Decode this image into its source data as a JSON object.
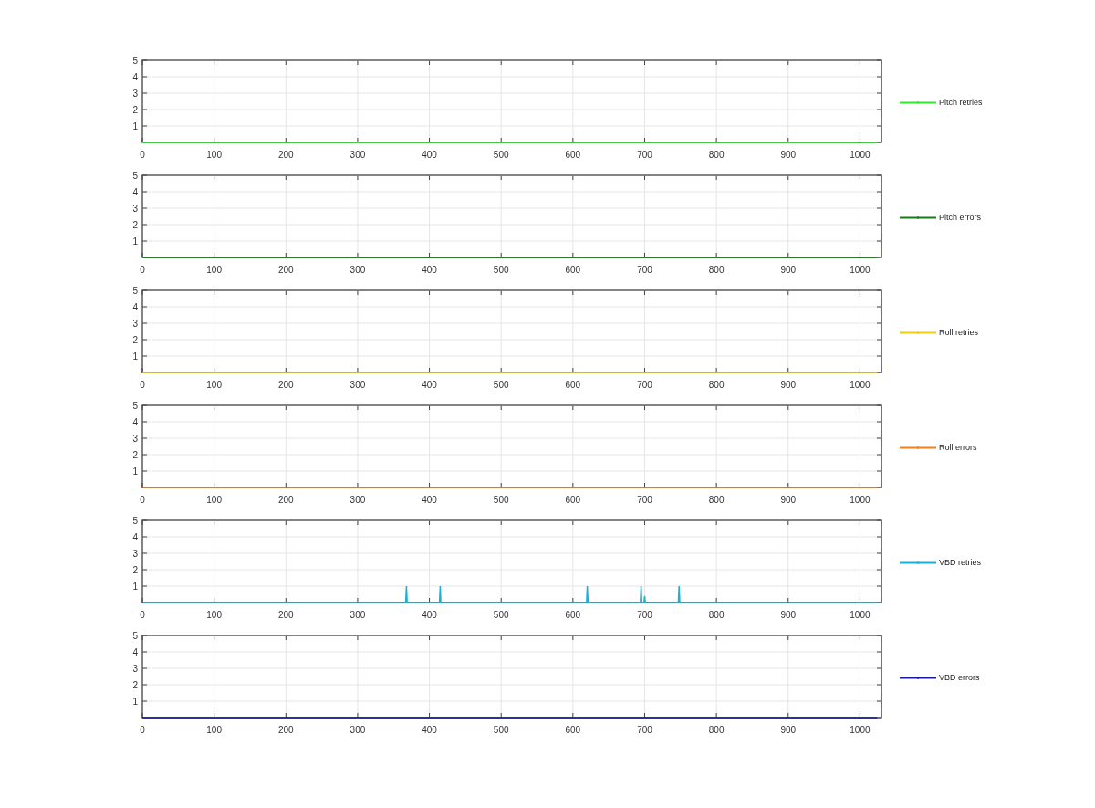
{
  "panels": [
    {
      "chart_data": {
        "type": "line",
        "x": [
          0,
          1024
        ],
        "series": [
          {
            "name": "Pitch retries",
            "color": "#33e633",
            "values": [
              0,
              0
            ]
          }
        ],
        "grid": true,
        "xlim": [
          0,
          1030
        ],
        "ylim": [
          0,
          5
        ],
        "xticks": [
          0,
          100,
          200,
          300,
          400,
          500,
          600,
          700,
          800,
          900,
          1000
        ],
        "yticks": [
          1,
          2,
          3,
          4,
          5
        ]
      }
    },
    {
      "chart_data": {
        "type": "line",
        "x": [
          0,
          1024
        ],
        "series": [
          {
            "name": "Pitch errors",
            "color": "#1a7a1a",
            "values": [
              0,
              0
            ]
          }
        ],
        "grid": true,
        "xlim": [
          0,
          1030
        ],
        "ylim": [
          0,
          5
        ],
        "xticks": [
          0,
          100,
          200,
          300,
          400,
          500,
          600,
          700,
          800,
          900,
          1000
        ],
        "yticks": [
          1,
          2,
          3,
          4,
          5
        ]
      }
    },
    {
      "chart_data": {
        "type": "line",
        "x": [
          0,
          1024
        ],
        "series": [
          {
            "name": "Roll retries",
            "color": "#f2cc1a",
            "values": [
              0,
              0
            ]
          }
        ],
        "grid": true,
        "xlim": [
          0,
          1030
        ],
        "ylim": [
          0,
          5
        ],
        "xticks": [
          0,
          100,
          200,
          300,
          400,
          500,
          600,
          700,
          800,
          900,
          1000
        ],
        "yticks": [
          1,
          2,
          3,
          4,
          5
        ]
      }
    },
    {
      "chart_data": {
        "type": "line",
        "x": [
          0,
          1024
        ],
        "series": [
          {
            "name": "Roll errors",
            "color": "#f08020",
            "values": [
              0,
              0
            ]
          }
        ],
        "grid": true,
        "xlim": [
          0,
          1030
        ],
        "ylim": [
          0,
          5
        ],
        "xticks": [
          0,
          100,
          200,
          300,
          400,
          500,
          600,
          700,
          800,
          900,
          1000
        ],
        "yticks": [
          1,
          2,
          3,
          4,
          5
        ]
      }
    },
    {
      "chart_data": {
        "type": "line",
        "x": [
          0,
          367,
          368,
          369,
          414,
          415,
          416,
          619,
          620,
          621,
          694,
          695,
          696,
          699,
          700,
          701,
          747,
          748,
          749,
          1024
        ],
        "series": [
          {
            "name": "VBD retries",
            "color": "#1ab0d8",
            "values": [
              0,
              0,
              1,
              0,
              0,
              1,
              0,
              0,
              1,
              0,
              0,
              1,
              0,
              0,
              0.4,
              0,
              0,
              1,
              0,
              0
            ]
          }
        ],
        "grid": true,
        "xlim": [
          0,
          1030
        ],
        "ylim": [
          0,
          5
        ],
        "xticks": [
          0,
          100,
          200,
          300,
          400,
          500,
          600,
          700,
          800,
          900,
          1000
        ],
        "yticks": [
          1,
          2,
          3,
          4,
          5
        ]
      }
    },
    {
      "chart_data": {
        "type": "line",
        "x": [
          0,
          1024
        ],
        "series": [
          {
            "name": "VBD errors",
            "color": "#1a1aa8",
            "values": [
              0,
              0
            ]
          }
        ],
        "grid": true,
        "xlim": [
          0,
          1030
        ],
        "ylim": [
          0,
          5
        ],
        "xticks": [
          0,
          100,
          200,
          300,
          400,
          500,
          600,
          700,
          800,
          900,
          1000
        ],
        "yticks": [
          1,
          2,
          3,
          4,
          5
        ]
      }
    }
  ]
}
